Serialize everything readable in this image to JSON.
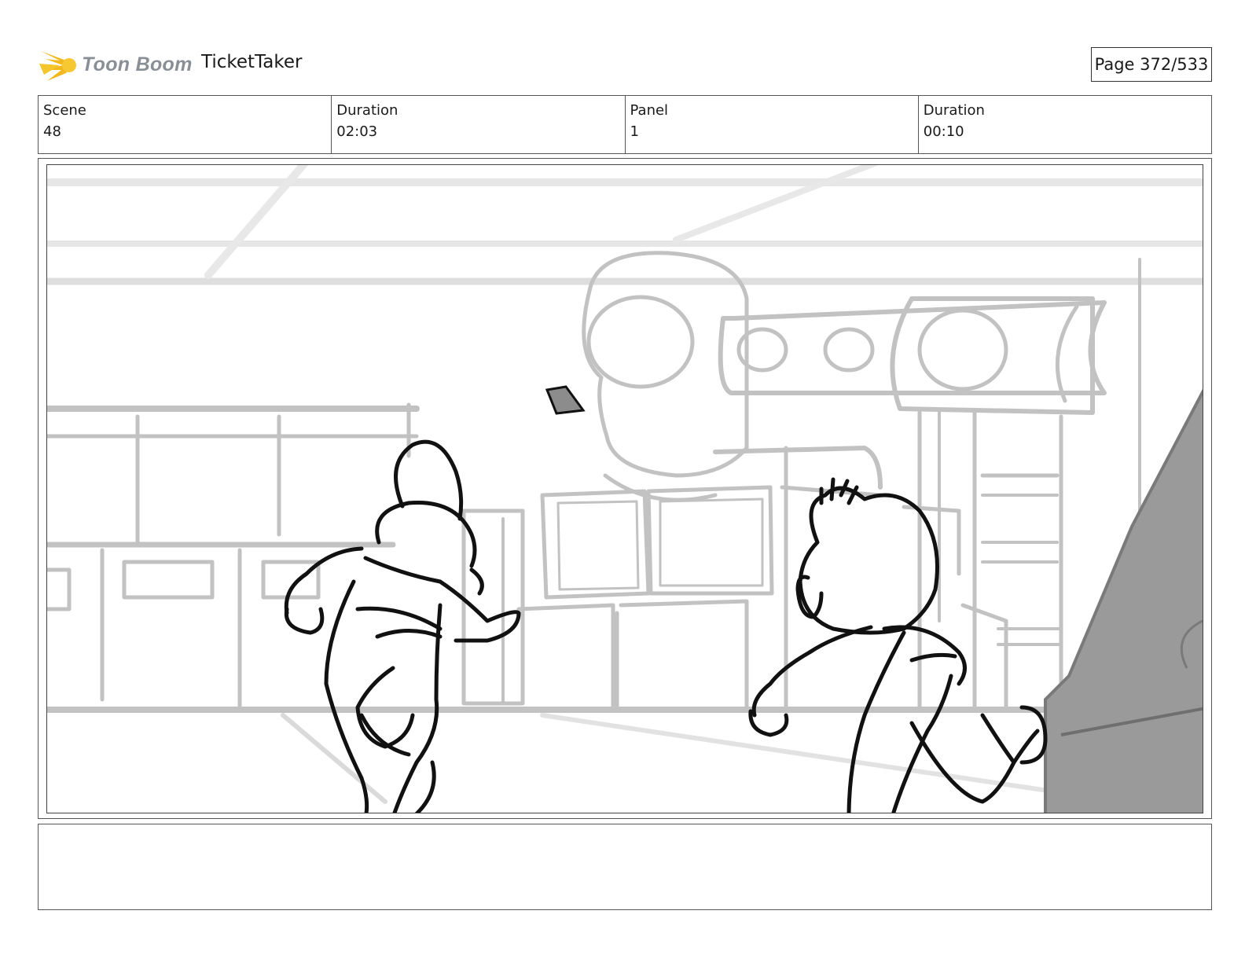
{
  "header": {
    "logo_text": "Toon Boom",
    "project_title": "TicketTaker",
    "page_label": "Page 372/533"
  },
  "info": {
    "scene_label": "Scene",
    "scene_value": "48",
    "scene_duration_label": "Duration",
    "scene_duration_value": "02:03",
    "panel_label": "Panel",
    "panel_value": "1",
    "panel_duration_label": "Duration",
    "panel_duration_value": "00:10"
  },
  "notes": {
    "text": ""
  },
  "colors": {
    "sketch_gray": "#bdbdbd",
    "ink": "#111111",
    "shade": "#9a9a9a",
    "logo_yellow": "#f2b91e"
  }
}
